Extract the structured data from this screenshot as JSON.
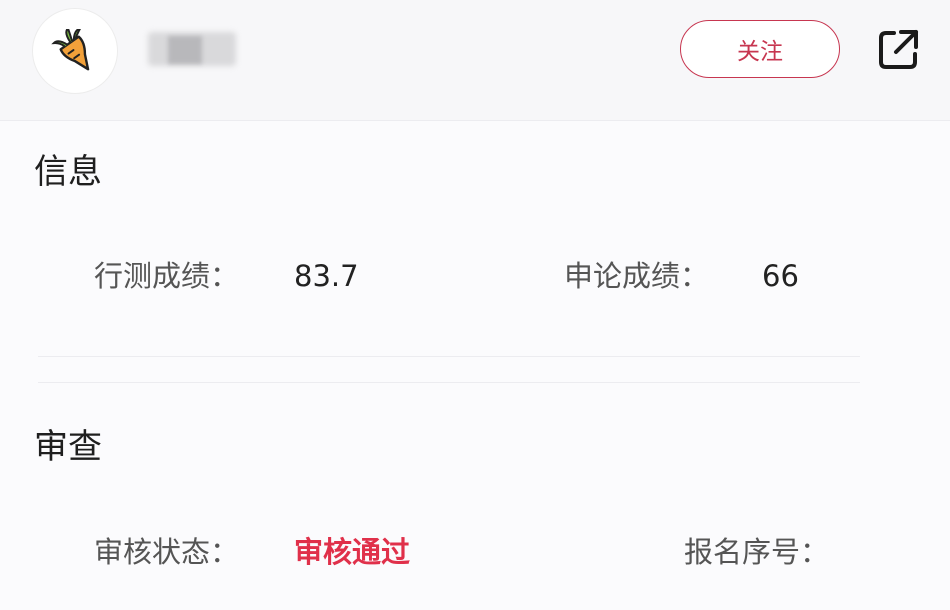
{
  "header": {
    "follow_label": "关注",
    "share_icon": "external-link-icon",
    "avatar_icon": "carrot-icon"
  },
  "info": {
    "title": "信息",
    "xingce_label": "行测成绩：",
    "xingce_value": "83.7",
    "shenlun_label": "申论成绩：",
    "shenlun_value": "66"
  },
  "review": {
    "title": "审查",
    "status_label": "审核状态：",
    "status_value": "审核通过",
    "reg_no_label": "报名序号："
  },
  "colors": {
    "accent": "#c73650",
    "status_pass": "#e0304a"
  }
}
